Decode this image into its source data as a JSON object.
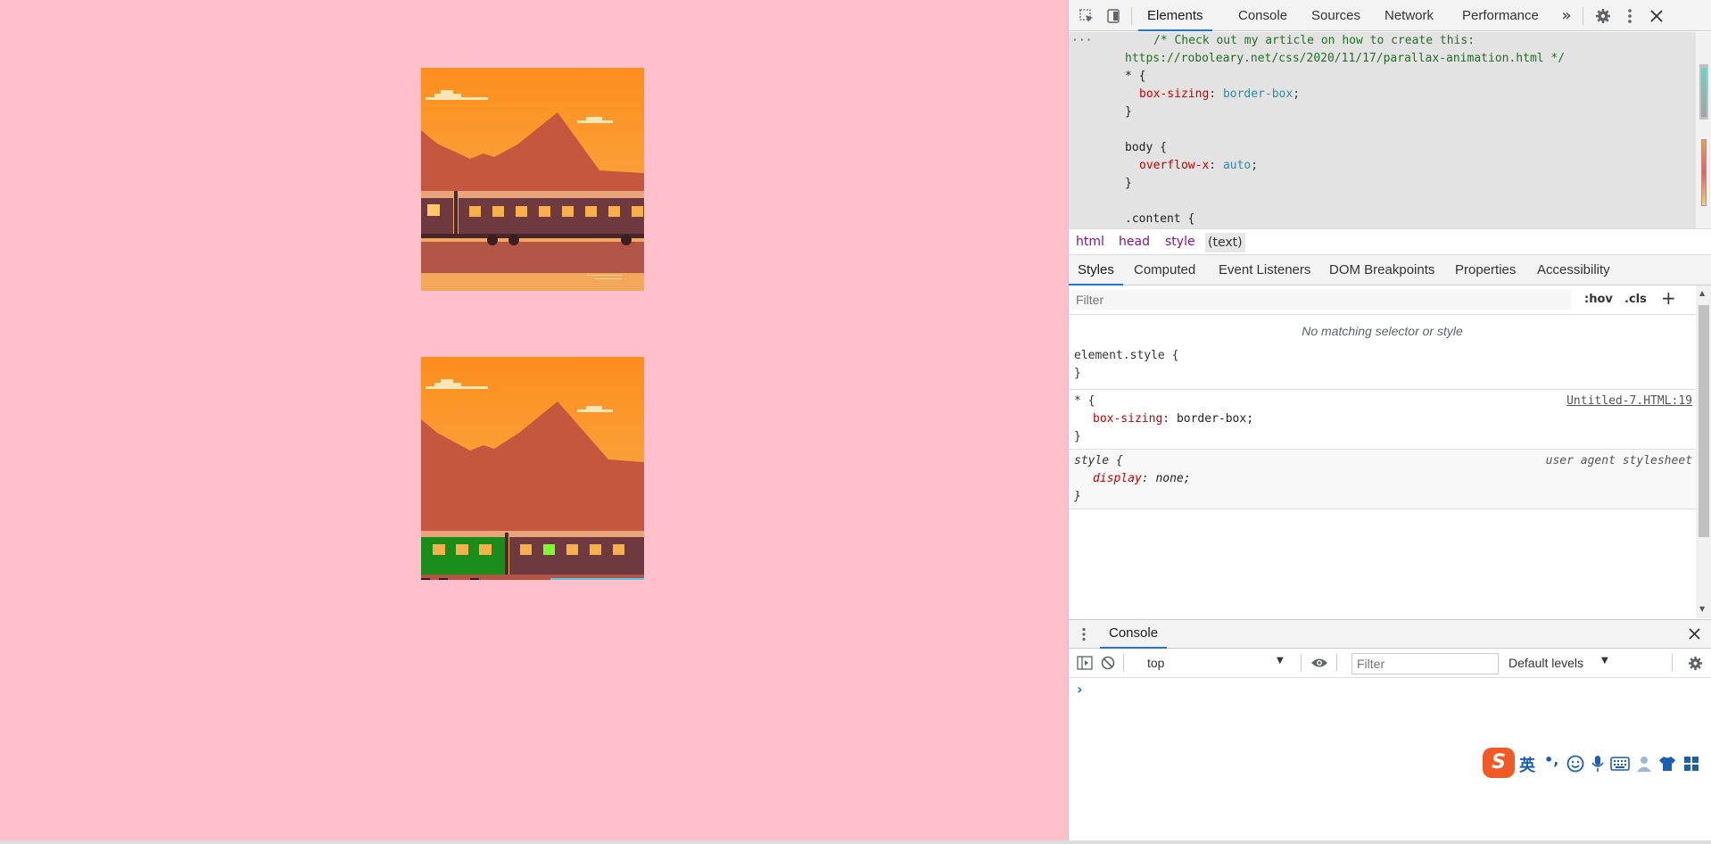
{
  "devtools": {
    "panel_tabs": [
      "Elements",
      "Console",
      "Sources",
      "Network",
      "Performance"
    ],
    "more_tabs_glyph": "»",
    "source_lines": {
      "comment1": "/* Check out my article on how to create this:",
      "comment2": "https://roboleary.net/css/2020/11/17/parallax-animation.html */",
      "star_sel": "* {",
      "boxsizing_prop": "box-sizing",
      "boxsizing_val": "border-box",
      "close1": "}",
      "body_sel": "body {",
      "overflow_prop": "overflow-x",
      "overflow_val": "auto",
      "close2": "}",
      "content_sel": ".content {"
    },
    "ellipsis": "···",
    "breadcrumbs": [
      "html",
      "head",
      "style",
      "(text)"
    ],
    "sub_tabs": [
      "Styles",
      "Computed",
      "Event Listeners",
      "DOM Breakpoints",
      "Properties",
      "Accessibility"
    ],
    "filter_placeholder": "Filter",
    "hov_label": ":hov",
    "cls_label": ".cls",
    "plus_label": "+",
    "no_match": "No matching selector or style",
    "element_style": "element.style {",
    "element_style_close": "}",
    "rule1": {
      "selector": "* {",
      "source_link": "Untitled-7.HTML:19",
      "prop": "box-sizing",
      "val": "border-box;",
      "close": "}"
    },
    "rule2": {
      "selector": "style {",
      "source_label": "user agent stylesheet",
      "prop": "display",
      "val": "none;",
      "close": "}"
    },
    "console": {
      "title": "Console",
      "context": "top",
      "filter_placeholder": "Filter",
      "levels": "Default levels",
      "prompt": "›"
    },
    "ime": {
      "logo": "S",
      "lang": "英",
      "punct": "•,"
    }
  }
}
